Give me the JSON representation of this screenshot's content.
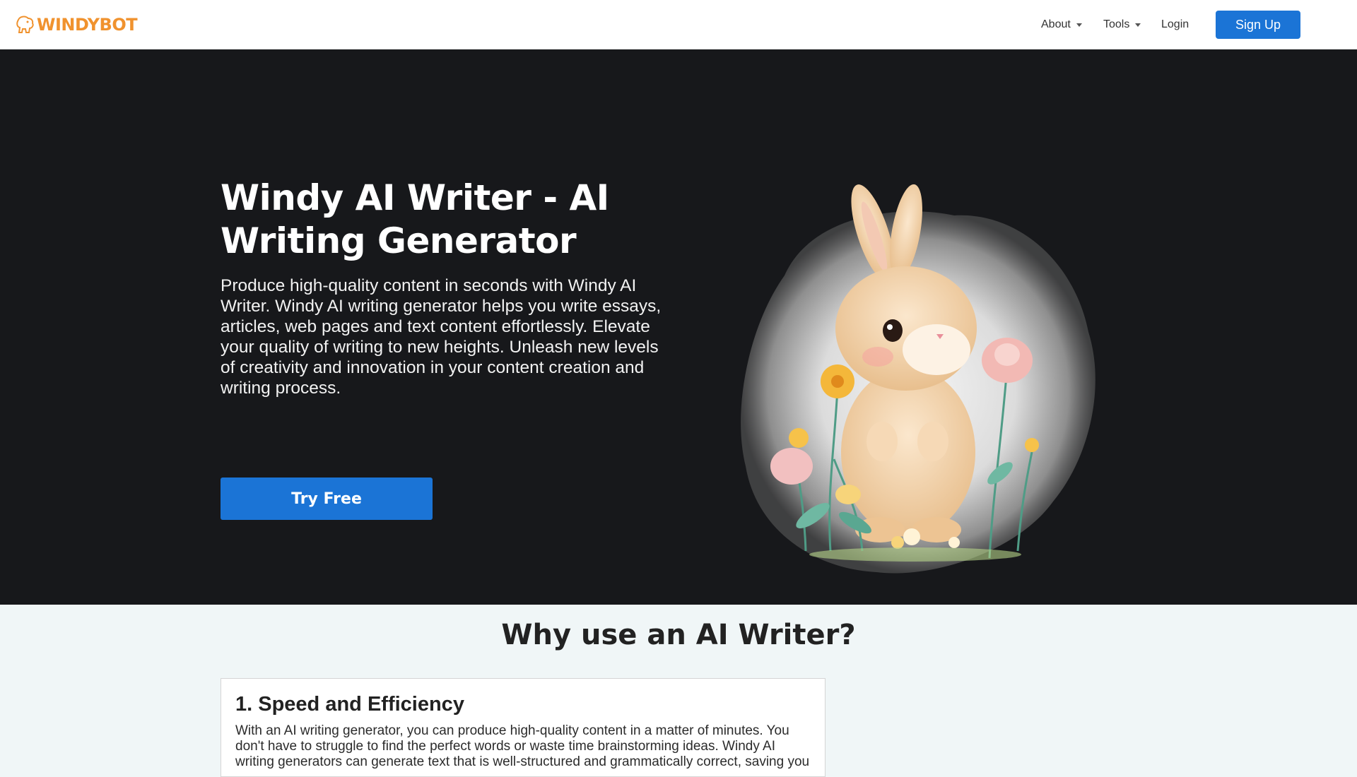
{
  "brand": {
    "name": "WINDYBOT",
    "color": "#f0922e",
    "logo_icon": "windybot-lion-icon"
  },
  "nav": {
    "about": "About",
    "tools": "Tools",
    "login": "Login",
    "signup": "Sign Up"
  },
  "hero": {
    "title": "Windy AI Writer - AI Writing Generator",
    "description": "Produce high-quality content in seconds with Windy AI Writer. Windy AI writing generator helps you write essays, articles, web pages and text content effortlessly. Elevate your quality of writing to new heights. Unleash new levels of creativity and innovation in your content creation and writing process.",
    "cta": "Try Free",
    "illustration": "watercolor-bunny-with-flowers"
  },
  "features": {
    "heading": "Why use an AI Writer?",
    "items": [
      {
        "title": "1. Speed and Efficiency",
        "text": "With an AI writing generator, you can produce high-quality content in a matter of minutes. You don't have to struggle to find the perfect words or waste time brainstorming ideas. Windy AI writing generators can generate text that is well-structured and grammatically correct, saving you"
      }
    ]
  },
  "colors": {
    "accent": "#1b74d6",
    "hero_bg": "#17181b",
    "section_bg": "#f0f6f7"
  }
}
